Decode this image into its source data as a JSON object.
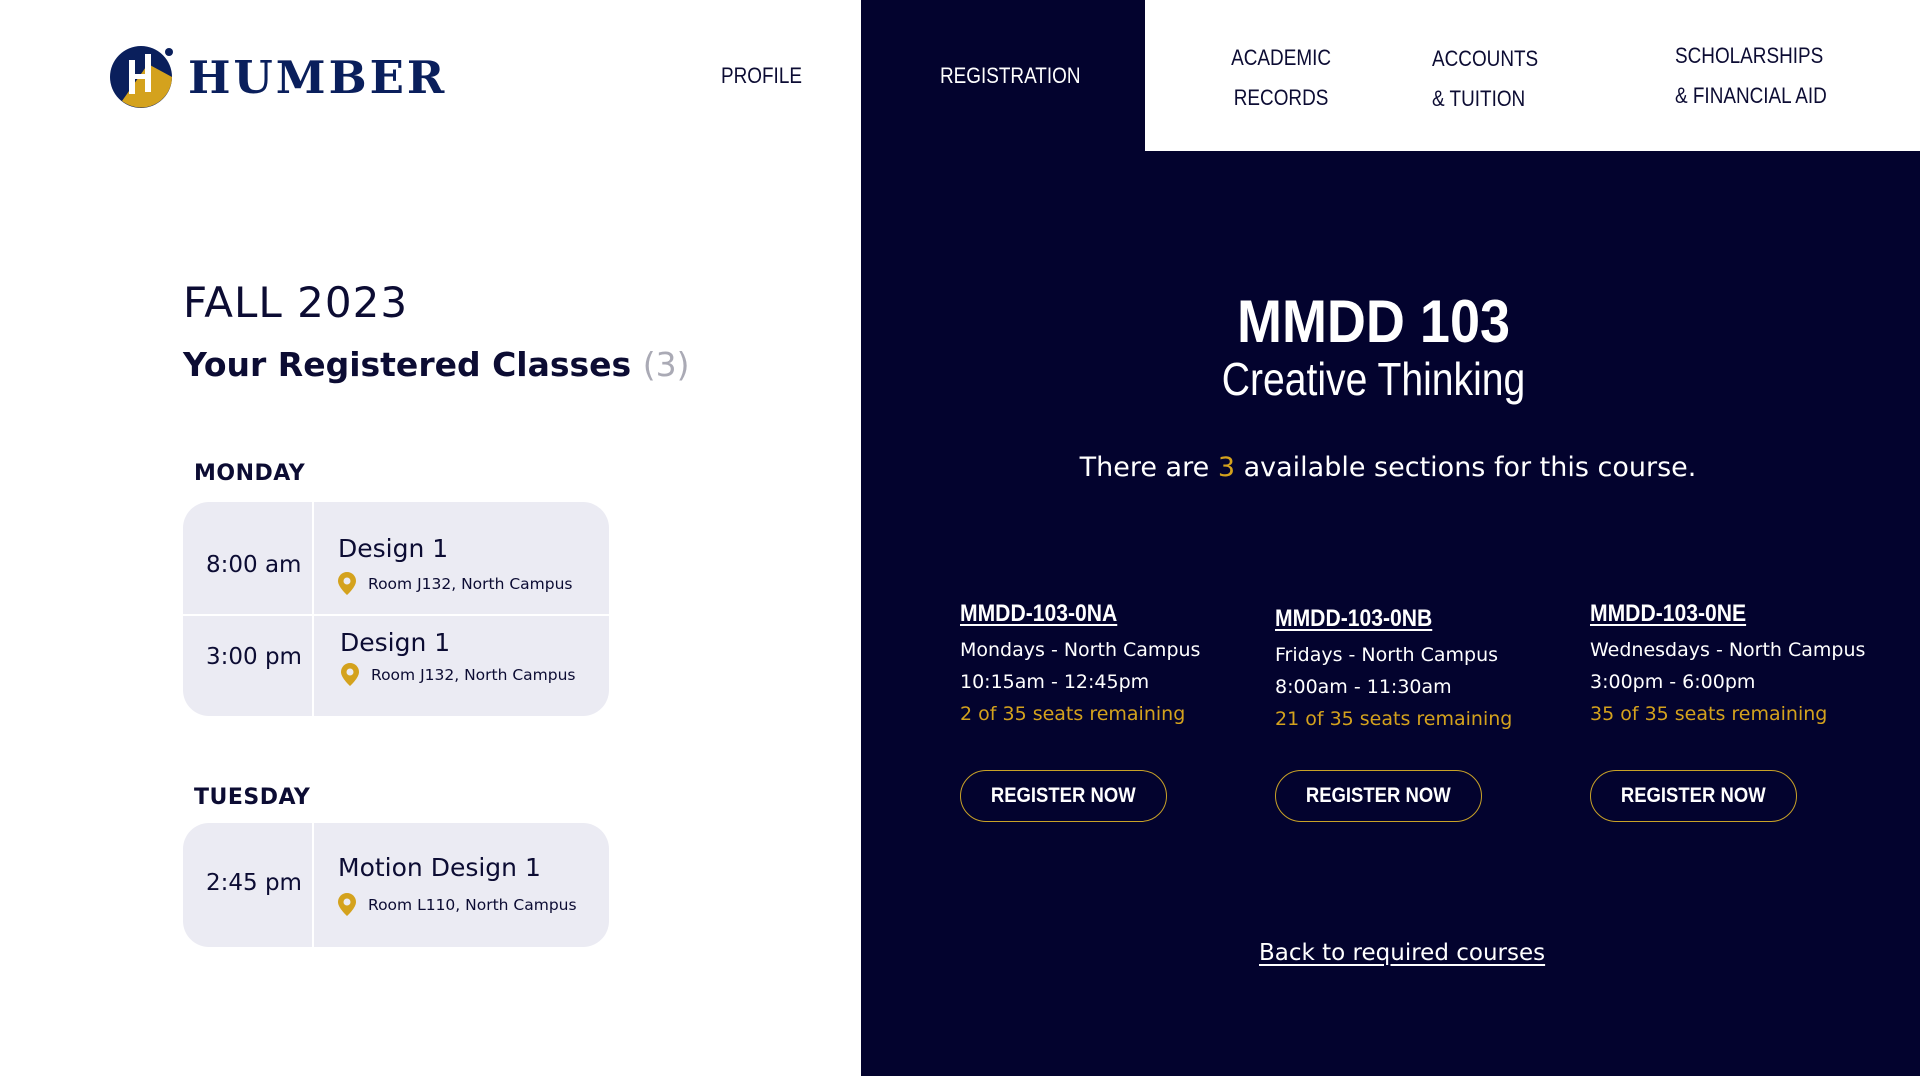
{
  "brand": {
    "name": "HUMBER",
    "accent": "#d4a21d",
    "navy": "#03032e"
  },
  "nav": {
    "profile": "PROFILE",
    "registration": "REGISTRATION",
    "academic_records": [
      "ACADEMIC",
      "RECORDS"
    ],
    "accounts_tuition": [
      "ACCOUNTS",
      "& TUITION"
    ],
    "scholarships": [
      "SCHOLARSHIPS",
      "& FINANCIAL AID"
    ]
  },
  "registered": {
    "term": "FALL 2023",
    "title": "Your Registered Classes",
    "count": "(3)",
    "days": [
      {
        "day": "MONDAY",
        "classes": [
          {
            "time": "8:00 am",
            "name": "Design 1",
            "location": "Room J132, North Campus"
          },
          {
            "time": "3:00 pm",
            "name": "Design 1",
            "location": "Room J132, North Campus"
          }
        ]
      },
      {
        "day": "TUESDAY",
        "classes": [
          {
            "time": "2:45 pm",
            "name": "Motion Design 1",
            "location": "Room L110, North Campus"
          }
        ]
      }
    ]
  },
  "course": {
    "code": "MMDD 103",
    "name": "Creative Thinking",
    "sections_msg_prefix": "There are",
    "sections_count": "3",
    "sections_msg_suffix": "available sections for this course.",
    "sections": [
      {
        "id": "MMDD-103-0NA",
        "days": "Mondays - North Campus",
        "time": "10:15am - 12:45pm",
        "seats": "2 of 35 seats remaining",
        "button": "REGISTER NOW"
      },
      {
        "id": "MMDD-103-0NB",
        "days": "Fridays - North Campus",
        "time": "8:00am - 11:30am",
        "seats": "21 of 35 seats remaining",
        "button": "REGISTER NOW"
      },
      {
        "id": "MMDD-103-0NE",
        "days": "Wednesdays - North Campus",
        "time": "3:00pm - 6:00pm",
        "seats": "35 of 35 seats remaining",
        "button": "REGISTER NOW"
      }
    ],
    "back_link": "Back to required courses"
  }
}
